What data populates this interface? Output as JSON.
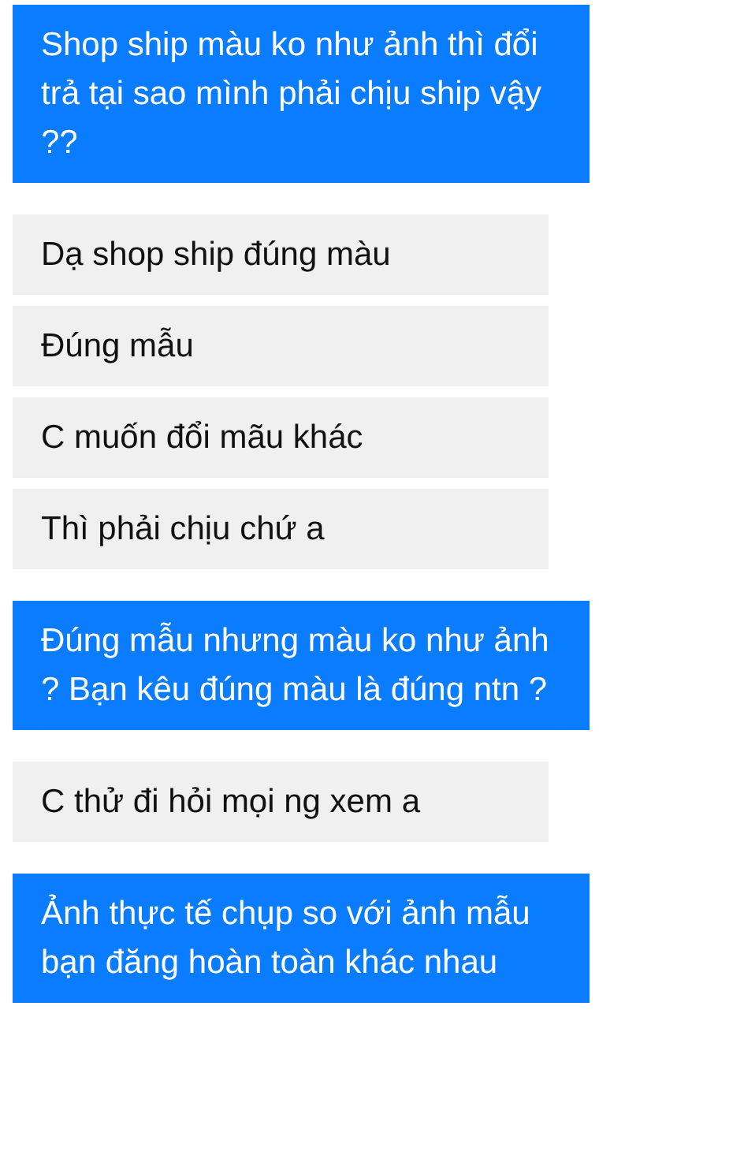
{
  "messages": [
    {
      "kind": "sent",
      "text": "Shop ship màu ko như ảnh thì đổi trả tại sao mình phải chịu ship vậy ??"
    },
    {
      "kind": "received",
      "text": "Dạ shop ship đúng màu"
    },
    {
      "kind": "received",
      "text": "Đúng mẫu"
    },
    {
      "kind": "received",
      "text": "C muốn đổi mãu khác"
    },
    {
      "kind": "received",
      "text": "Thì phải chịu chứ a"
    },
    {
      "kind": "sent",
      "text": "Đúng mẫu nhưng màu ko như ảnh ? Bạn kêu đúng màu là đúng ntn ?"
    },
    {
      "kind": "received",
      "text": "C thử đi hỏi mọi ng xem a"
    },
    {
      "kind": "sent",
      "text": "Ảnh thực tế chụp so với ảnh mẫu bạn đăng hoàn toàn khác nhau"
    }
  ]
}
